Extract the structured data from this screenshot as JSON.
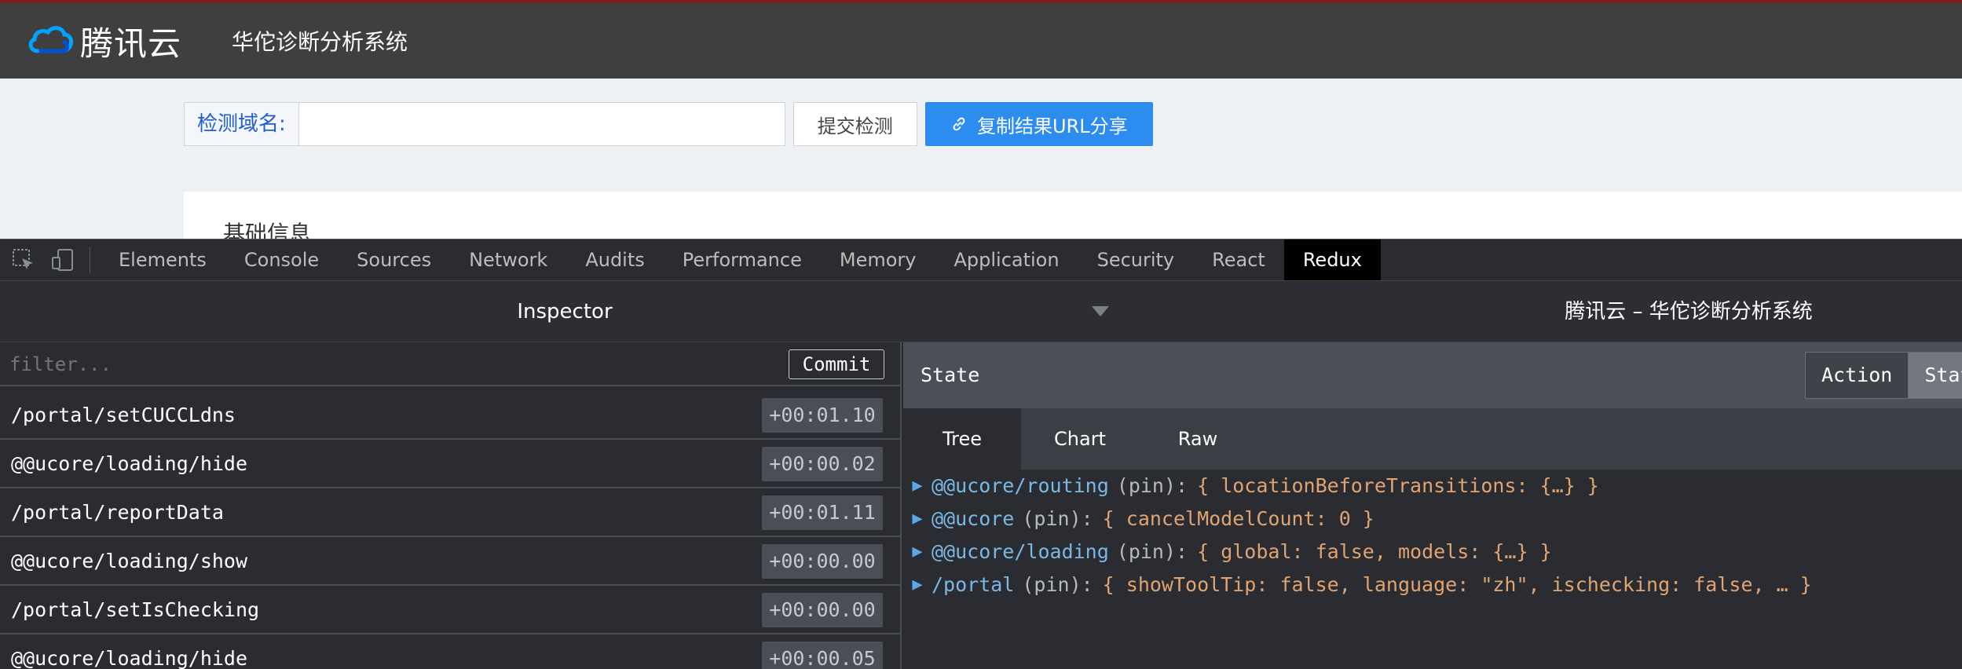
{
  "header": {
    "brand_name": "腾讯云",
    "system_name": "华佗诊断分析系统"
  },
  "search": {
    "label": "检测域名:",
    "input_value": "",
    "submit_label": "提交检测",
    "share_label": "复制结果URL分享"
  },
  "card": {
    "title": "基础信息"
  },
  "devtools": {
    "tabs": [
      "Elements",
      "Console",
      "Sources",
      "Network",
      "Audits",
      "Performance",
      "Memory",
      "Application",
      "Security",
      "React",
      "Redux"
    ],
    "active_tab": "Redux"
  },
  "redux": {
    "monitor_label": "Inspector",
    "instance_label": "腾讯云 – 华佗诊断分析系统",
    "filter_placeholder": "filter...",
    "commit_label": "Commit",
    "actions": [
      {
        "name": "/portal/setCUCCLdns",
        "time": "+00:01.10"
      },
      {
        "name": "@@ucore/loading/hide",
        "time": "+00:00.02"
      },
      {
        "name": "/portal/reportData",
        "time": "+00:01.11"
      },
      {
        "name": "@@ucore/loading/show",
        "time": "+00:00.00"
      },
      {
        "name": "/portal/setIsChecking",
        "time": "+00:00.00"
      },
      {
        "name": "@@ucore/loading/hide",
        "time": "+00:00.05"
      }
    ],
    "right_title": "State",
    "segment": [
      "Action",
      "State"
    ],
    "view_tabs": [
      "Tree",
      "Chart",
      "Raw"
    ],
    "active_view": "Tree",
    "tree": [
      {
        "key": "@@ucore/routing",
        "pin": "(pin):",
        "value": "{ locationBeforeTransitions: {…} }"
      },
      {
        "key": "@@ucore",
        "pin": "(pin):",
        "value": "{ cancelModelCount: 0 }"
      },
      {
        "key": "@@ucore/loading",
        "pin": "(pin):",
        "value": "{ global: false, models: {…} }"
      },
      {
        "key": "/portal",
        "pin": "(pin):",
        "value": "{ showToolTip: false, language: \"zh\", ischecking: false, … }"
      }
    ]
  },
  "colors": {
    "header_bg": "#3f3f3f",
    "accent_blue": "#2d8cf0",
    "devtools_bg": "#2a2c31"
  }
}
